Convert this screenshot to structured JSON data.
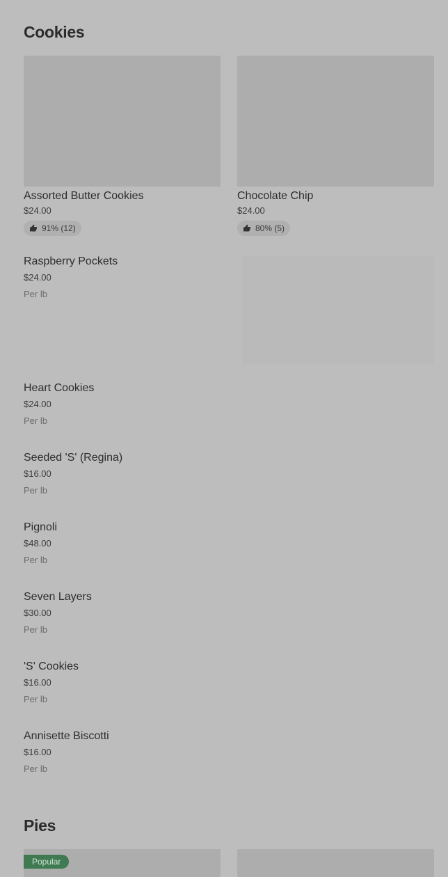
{
  "sections": {
    "cookies": {
      "title": "Cookies"
    },
    "pies": {
      "title": "Pies"
    }
  },
  "featured": [
    {
      "name": "Assorted Butter Cookies",
      "price": "$24.00",
      "rating": "91% (12)"
    },
    {
      "name": "Chocolate Chip",
      "price": "$24.00",
      "rating": "80% (5)"
    }
  ],
  "items": [
    {
      "name": "Raspberry Pockets",
      "price": "$24.00",
      "unit": "Per lb"
    },
    {
      "name": "Heart Cookies",
      "price": "$24.00",
      "unit": "Per lb"
    },
    {
      "name": "Seeded 'S' (Regina)",
      "price": "$16.00",
      "unit": "Per lb"
    },
    {
      "name": "Pignoli",
      "price": "$48.00",
      "unit": "Per lb"
    },
    {
      "name": "Seven Layers",
      "price": "$30.00",
      "unit": "Per lb"
    },
    {
      "name": "'S' Cookies",
      "price": "$16.00",
      "unit": "Per lb"
    },
    {
      "name": "Annisette Biscotti",
      "price": "$16.00",
      "unit": "Per lb"
    }
  ],
  "pies": {
    "badge": "Popular"
  },
  "icons": {
    "rating": "thumbs-up-icon"
  },
  "colors": {
    "badge_bg": "#3f7a52",
    "background": "#bdbdbd"
  }
}
